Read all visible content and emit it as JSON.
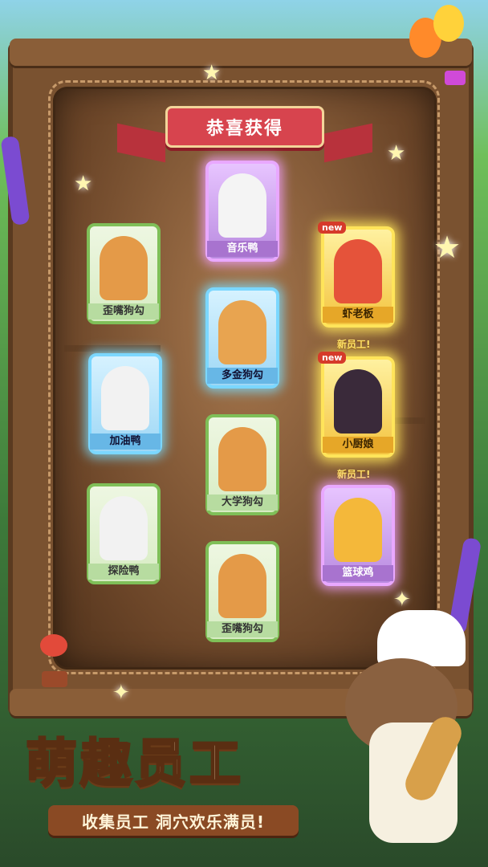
{
  "banner_title": "恭喜获得",
  "cards": [
    {
      "name": "歪嘴狗勾",
      "rarity": "green"
    },
    {
      "name": "音乐鸭",
      "rarity": "purple"
    },
    {
      "name": "虾老板",
      "rarity": "gold",
      "badge": "new",
      "note": "新员工!"
    },
    {
      "name": "多金狗勾",
      "rarity": "blue"
    },
    {
      "name": "加油鸭",
      "rarity": "blue"
    },
    {
      "name": "小厨娘",
      "rarity": "gold",
      "badge": "new",
      "note": "新员工!"
    },
    {
      "name": "大学狗勾",
      "rarity": "green"
    },
    {
      "name": "探险鸭",
      "rarity": "green"
    },
    {
      "name": "篮球鸡",
      "rarity": "purple"
    },
    {
      "name": "歪嘴狗勾",
      "rarity": "green"
    }
  ],
  "headline": "萌趣员工",
  "tagline": "收集员工 洞穴欢乐满员!",
  "colors": {
    "gold": "#ffe45a",
    "purple": "#e9a8ff",
    "blue": "#7bd7ff",
    "green": "#7fbf58",
    "ribbon": "#d7444e"
  }
}
